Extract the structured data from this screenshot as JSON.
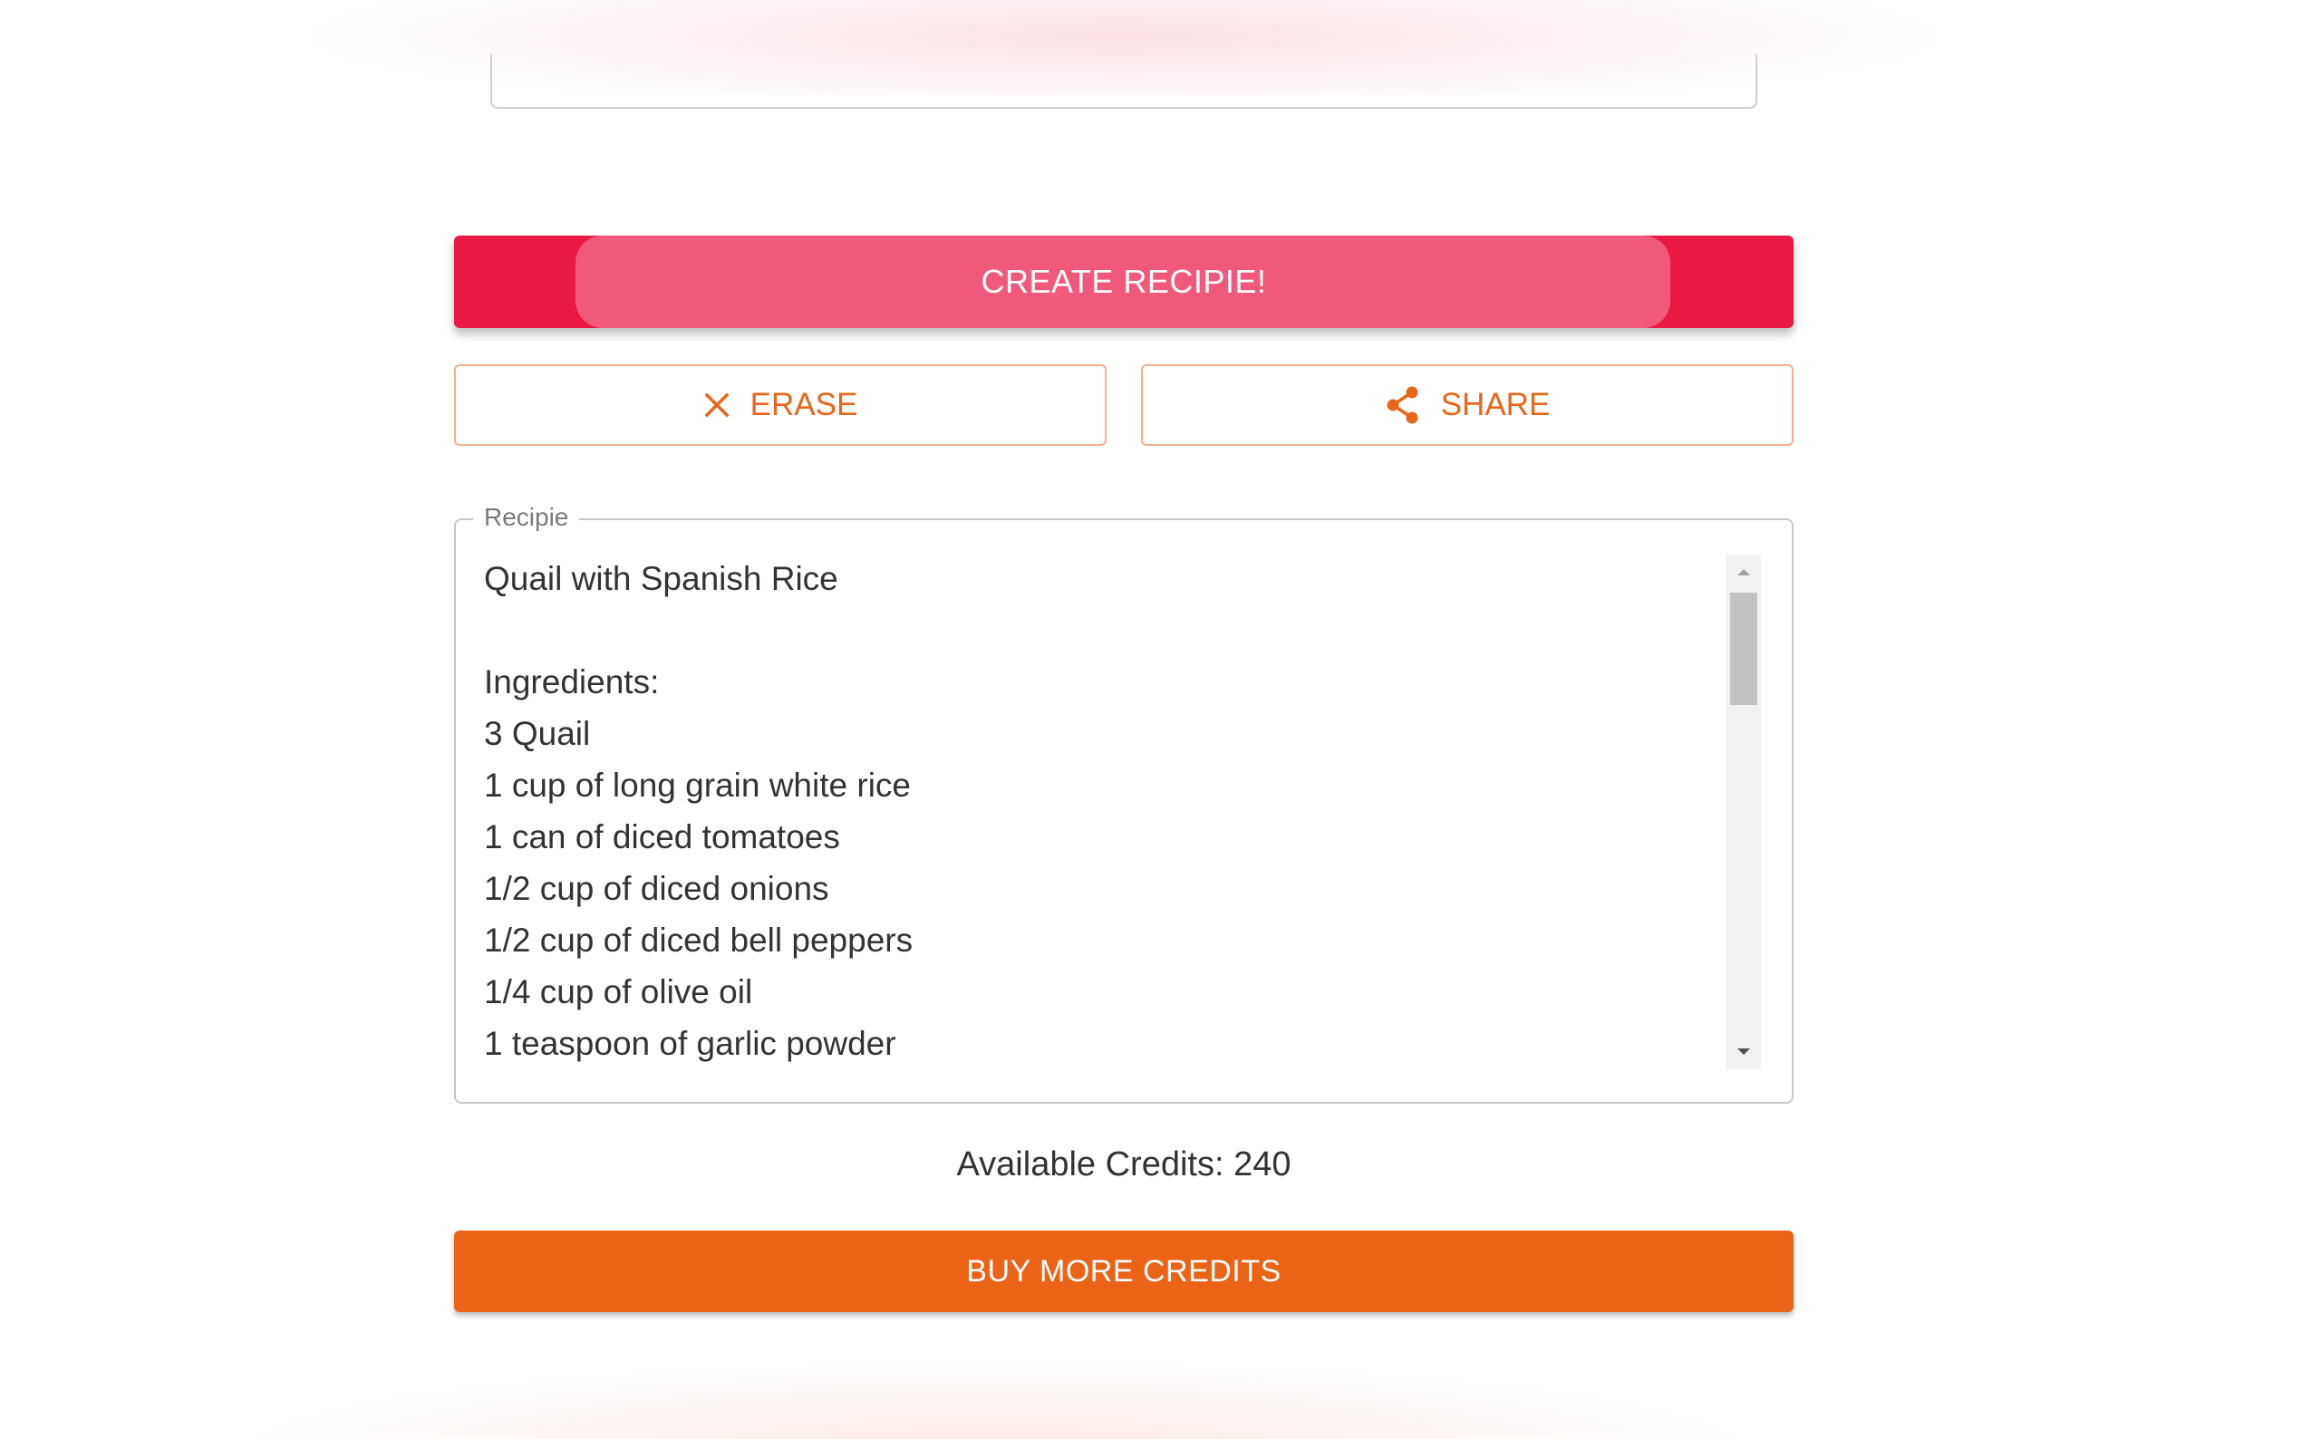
{
  "actions": {
    "create_label": "CREATE RECIPIE!",
    "erase_label": "ERASE",
    "share_label": "SHARE",
    "buy_label": "BUY MORE CREDITS"
  },
  "recipe": {
    "legend": "Recipie",
    "lines": [
      "Quail with Spanish Rice",
      "",
      "Ingredients:",
      "3 Quail",
      "1 cup of long grain white rice",
      "1 can of diced tomatoes",
      "1/2 cup of diced onions",
      "1/2 cup of diced bell peppers",
      "1/4 cup of olive oil",
      "1 teaspoon of garlic powder"
    ]
  },
  "credits": {
    "text": "Available Credits: 240"
  },
  "icons": {
    "erase": "close-icon",
    "share": "share-icon"
  },
  "colors": {
    "create_button": "#e91944",
    "create_button_highlight": "#f0597b",
    "accent_orange": "#ea6316",
    "outline_border": "#f3b08e"
  }
}
